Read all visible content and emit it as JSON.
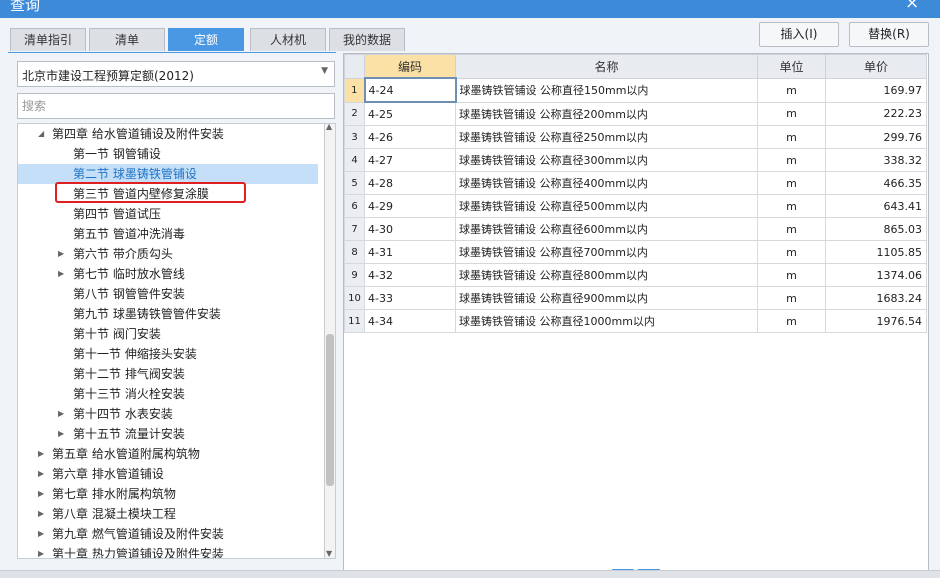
{
  "window": {
    "title": "查询",
    "close": "×"
  },
  "tabs": [
    {
      "label": "清单指引",
      "active": false
    },
    {
      "label": "清单",
      "active": false
    },
    {
      "label": "定额",
      "active": true
    },
    {
      "label": "人材机",
      "active": false
    },
    {
      "label": "我的数据",
      "active": false
    }
  ],
  "buttons": {
    "insert": "插入(I)",
    "replace": "替换(R)"
  },
  "left": {
    "dropdown_value": "北京市建设工程预算定额(2012)",
    "search_placeholder": "搜索"
  },
  "tree": [
    {
      "label": "第四章 给水管道铺设及附件安装",
      "level": 0,
      "toggle": "expanded"
    },
    {
      "label": "第一节 钢管铺设",
      "level": 1,
      "toggle": "none"
    },
    {
      "label": "第二节 球墨铸铁管铺设",
      "level": 1,
      "toggle": "none",
      "selected": true
    },
    {
      "label": "第三节 管道内壁修复涂膜",
      "level": 1,
      "toggle": "none"
    },
    {
      "label": "第四节 管道试压",
      "level": 1,
      "toggle": "none"
    },
    {
      "label": "第五节 管道冲洗消毒",
      "level": 1,
      "toggle": "none"
    },
    {
      "label": "第六节 带介质勾头",
      "level": 1,
      "toggle": "collapsed"
    },
    {
      "label": "第七节 临时放水管线",
      "level": 1,
      "toggle": "collapsed"
    },
    {
      "label": "第八节 钢管管件安装",
      "level": 1,
      "toggle": "none"
    },
    {
      "label": "第九节 球墨铸铁管管件安装",
      "level": 1,
      "toggle": "none"
    },
    {
      "label": "第十节 阀门安装",
      "level": 1,
      "toggle": "none"
    },
    {
      "label": "第十一节 伸缩接头安装",
      "level": 1,
      "toggle": "none"
    },
    {
      "label": "第十二节 排气阀安装",
      "level": 1,
      "toggle": "none"
    },
    {
      "label": "第十三节 消火栓安装",
      "level": 1,
      "toggle": "none"
    },
    {
      "label": "第十四节 水表安装",
      "level": 1,
      "toggle": "collapsed"
    },
    {
      "label": "第十五节 流量计安装",
      "level": 1,
      "toggle": "collapsed"
    },
    {
      "label": "第五章 给水管道附属构筑物",
      "level": 0,
      "toggle": "collapsed"
    },
    {
      "label": "第六章 排水管道铺设",
      "level": 0,
      "toggle": "collapsed"
    },
    {
      "label": "第七章 排水附属构筑物",
      "level": 0,
      "toggle": "collapsed"
    },
    {
      "label": "第八章 混凝土模块工程",
      "level": 0,
      "toggle": "collapsed"
    },
    {
      "label": "第九章 燃气管道铺设及附件安装",
      "level": 0,
      "toggle": "collapsed"
    },
    {
      "label": "第十章 热力管道铺设及附件安装",
      "level": 0,
      "toggle": "collapsed"
    }
  ],
  "table": {
    "headers": [
      "编码",
      "名称",
      "单位",
      "单价"
    ],
    "rows": [
      {
        "no": "1",
        "code": "4-24",
        "name": "球墨铸铁管铺设 公称直径150mm以内",
        "unit": "m",
        "price": "169.97"
      },
      {
        "no": "2",
        "code": "4-25",
        "name": "球墨铸铁管铺设 公称直径200mm以内",
        "unit": "m",
        "price": "222.23"
      },
      {
        "no": "3",
        "code": "4-26",
        "name": "球墨铸铁管铺设 公称直径250mm以内",
        "unit": "m",
        "price": "299.76"
      },
      {
        "no": "4",
        "code": "4-27",
        "name": "球墨铸铁管铺设 公称直径300mm以内",
        "unit": "m",
        "price": "338.32"
      },
      {
        "no": "5",
        "code": "4-28",
        "name": "球墨铸铁管铺设 公称直径400mm以内",
        "unit": "m",
        "price": "466.35"
      },
      {
        "no": "6",
        "code": "4-29",
        "name": "球墨铸铁管铺设 公称直径500mm以内",
        "unit": "m",
        "price": "643.41"
      },
      {
        "no": "7",
        "code": "4-30",
        "name": "球墨铸铁管铺设 公称直径600mm以内",
        "unit": "m",
        "price": "865.03"
      },
      {
        "no": "8",
        "code": "4-31",
        "name": "球墨铸铁管铺设 公称直径700mm以内",
        "unit": "m",
        "price": "1105.85"
      },
      {
        "no": "9",
        "code": "4-32",
        "name": "球墨铸铁管铺设 公称直径800mm以内",
        "unit": "m",
        "price": "1374.06"
      },
      {
        "no": "10",
        "code": "4-33",
        "name": "球墨铸铁管铺设 公称直径900mm以内",
        "unit": "m",
        "price": "1683.24"
      },
      {
        "no": "11",
        "code": "4-34",
        "name": "球墨铸铁管铺设 公称直径1000mm以内",
        "unit": "m",
        "price": "1976.54"
      }
    ]
  },
  "colors": {
    "accent": "#4a97e3",
    "titlebar": "#3d8ad8",
    "selection": "#c4dff7",
    "highlight_box": "#e02020",
    "sorted_header": "#fbe1a6"
  }
}
